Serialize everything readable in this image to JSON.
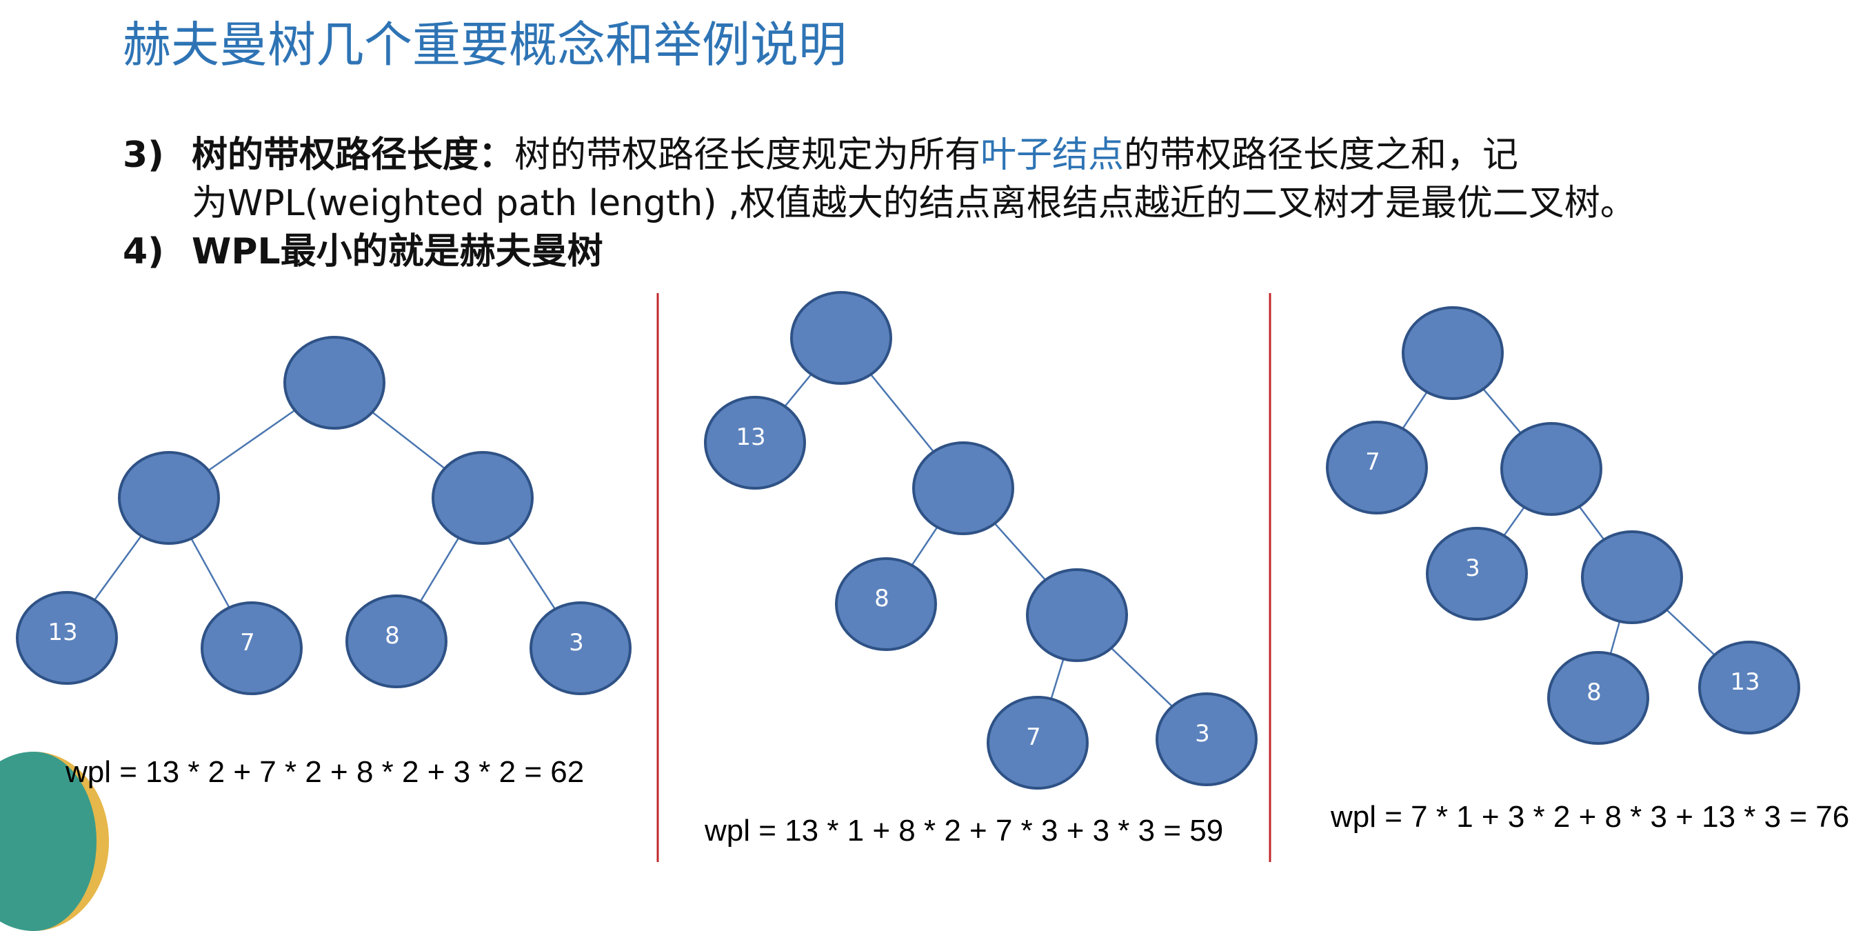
{
  "slide": {
    "title": "赫夫曼树几个重要概念和举例说明",
    "highlight_color": "#2e74b5",
    "points": [
      {
        "number": "3)",
        "term": "树的带权路径长度：",
        "text_before": "树的带权路径长度规定为所有",
        "highlight": "叶子结点",
        "text_after": "的带权路径长度之和，记",
        "line2": "为WPL(weighted path length) ,权值越大的结点离根结点越近的二叉树才是最优二叉树。"
      },
      {
        "number": "4)",
        "text": "WPL最小的就是赫夫曼树"
      }
    ]
  },
  "trees": [
    {
      "nodes": [
        {
          "id": "r",
          "label": ""
        },
        {
          "id": "a",
          "label": ""
        },
        {
          "id": "b",
          "label": ""
        },
        {
          "id": "l13",
          "label": "13"
        },
        {
          "id": "l7",
          "label": "7"
        },
        {
          "id": "l8",
          "label": "8"
        },
        {
          "id": "l3",
          "label": "3"
        }
      ],
      "edges": [
        [
          "r",
          "a"
        ],
        [
          "r",
          "b"
        ],
        [
          "a",
          "l13"
        ],
        [
          "a",
          "l7"
        ],
        [
          "b",
          "l8"
        ],
        [
          "b",
          "l3"
        ]
      ],
      "formula": "wpl = 13 * 2 + 7 * 2 + 8 * 2 + 3 * 2 = 62"
    },
    {
      "nodes": [
        {
          "id": "r",
          "label": ""
        },
        {
          "id": "l13",
          "label": "13"
        },
        {
          "id": "i1",
          "label": ""
        },
        {
          "id": "l8",
          "label": "8"
        },
        {
          "id": "i2",
          "label": ""
        },
        {
          "id": "l7",
          "label": "7"
        },
        {
          "id": "l3",
          "label": "3"
        }
      ],
      "edges": [
        [
          "r",
          "l13"
        ],
        [
          "r",
          "i1"
        ],
        [
          "i1",
          "l8"
        ],
        [
          "i1",
          "i2"
        ],
        [
          "i2",
          "l7"
        ],
        [
          "i2",
          "l3"
        ]
      ],
      "formula": "wpl = 13 * 1 + 8 * 2 + 7 * 3 + 3 * 3 = 59"
    },
    {
      "nodes": [
        {
          "id": "r",
          "label": ""
        },
        {
          "id": "l7",
          "label": "7"
        },
        {
          "id": "i1",
          "label": ""
        },
        {
          "id": "l3",
          "label": "3"
        },
        {
          "id": "i2",
          "label": ""
        },
        {
          "id": "l8",
          "label": "8"
        },
        {
          "id": "l13",
          "label": "13"
        }
      ],
      "edges": [
        [
          "r",
          "l7"
        ],
        [
          "r",
          "i1"
        ],
        [
          "i1",
          "l3"
        ],
        [
          "i1",
          "i2"
        ],
        [
          "i2",
          "l8"
        ],
        [
          "i2",
          "l13"
        ]
      ],
      "formula": "wpl = 7 * 1 + 3 * 2 + 8 * 3 + 13 * 3 = 76"
    }
  ]
}
